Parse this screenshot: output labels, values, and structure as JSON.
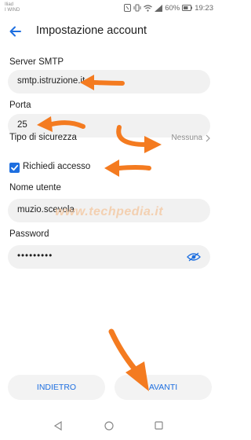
{
  "status": {
    "carrier_line1": "Iliad",
    "carrier_line2": "I WIND",
    "battery": "60%",
    "time": "19:23"
  },
  "appbar": {
    "title": "Impostazione account"
  },
  "form": {
    "smtp_label": "Server SMTP",
    "smtp_value": "smtp.istruzione.it",
    "port_label": "Porta",
    "port_value": "25",
    "security_label": "Tipo di sicurezza",
    "security_value": "Nessuna",
    "auth_label": "Richiedi accesso",
    "auth_checked": true,
    "user_label": "Nome utente",
    "user_value": "muzio.scevola",
    "password_label": "Password",
    "password_value": "•••••••••"
  },
  "watermark": "www.techpedia.it",
  "buttons": {
    "prev": "INDIETRO",
    "next": "AVANTI"
  },
  "colors": {
    "accent": "#1e6fe0",
    "field_bg": "#f1f1f1",
    "annotation_arrow": "#f47b20"
  }
}
